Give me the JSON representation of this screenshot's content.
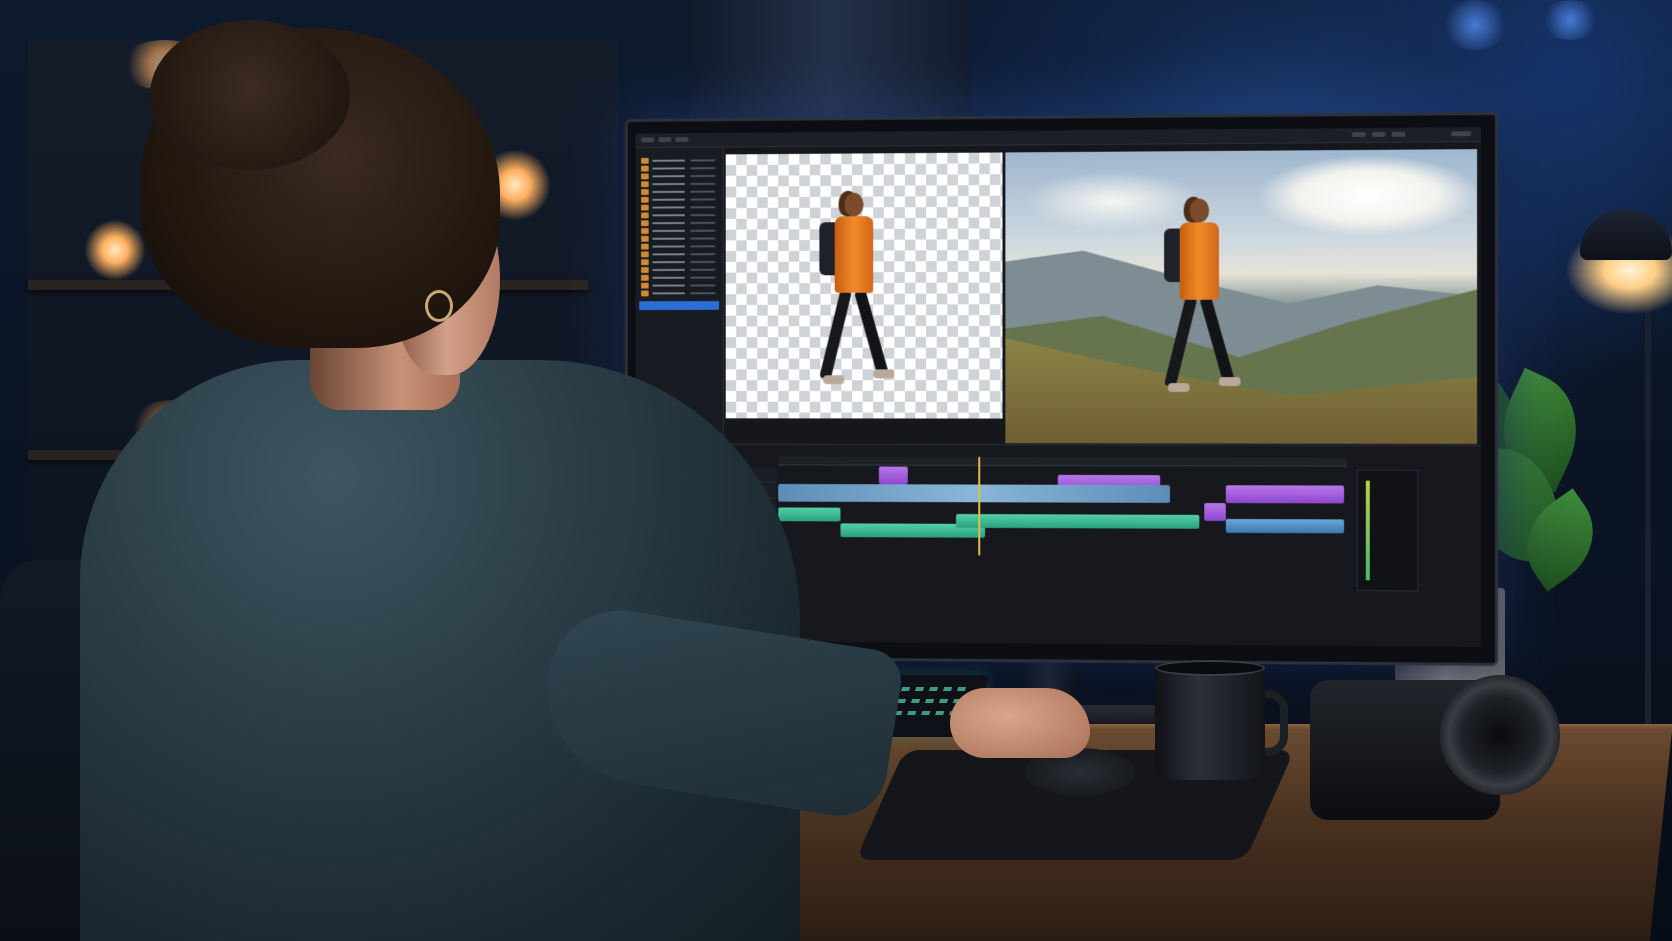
{
  "scene": {
    "subject": "",
    "screen_app": "",
    "colors": {
      "room": "#0d1a2e",
      "accent_blue": "#2b6fd6",
      "jacket_orange": "#f08a28",
      "clip_purple": "#8e46d0",
      "clip_teal": "#2a9f7d",
      "clip_video": "#5d8db8"
    },
    "icons": [
      "folder-icon",
      "play-icon",
      "eye-icon",
      "lock-icon"
    ]
  }
}
